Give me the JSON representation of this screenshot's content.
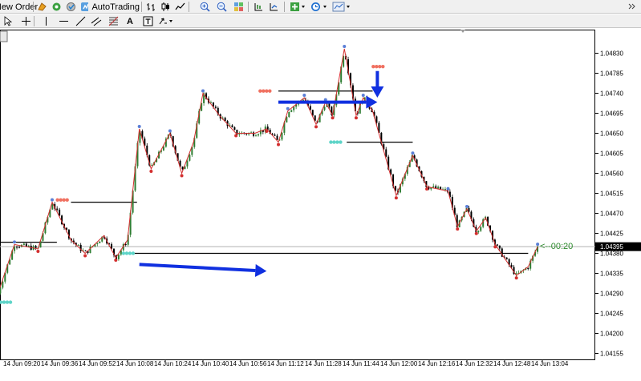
{
  "toolbar": {
    "new_order_label": "New Order",
    "autotrading_label": "AutoTrading",
    "icons": [
      "new-order-icon",
      "expert-icon",
      "signals-icon",
      "autotrading-icon",
      "bar-chart-icon",
      "candlestick-icon",
      "line-chart-icon",
      "zoom-in-icon",
      "zoom-out-icon",
      "tile-windows-icon",
      "chart-shift-icon",
      "autoscroll-icon",
      "indicators-icon",
      "periods-icon",
      "templates-icon"
    ]
  },
  "drawing_toolbar": {
    "icons": [
      "cursor-icon",
      "crosshair-icon",
      "vertical-line-icon",
      "horizontal-line-icon",
      "trendline-icon",
      "equidistant-channel-icon",
      "fibonacci-icon",
      "text-label-icon",
      "text-icon",
      "arrows-icon"
    ],
    "text_tool_label": "A"
  },
  "colors": {
    "bull_candle": "#2e7d32",
    "bear_candle": "#000000",
    "zigzag_line": "#d32f2f",
    "high_dot": "#5b7fd6",
    "low_dot": "#d32f2f",
    "resistance_marker": "#f07060",
    "support_marker": "#5ed4c8",
    "arrow": "#1030e0",
    "countdown_text": "#2e8b2e",
    "price_tag_bg": "#000000"
  },
  "chart_data": {
    "type": "candlestick",
    "y_ticks": [
      "1.04830",
      "1.04785",
      "1.04740",
      "1.04695",
      "1.04650",
      "1.04605",
      "1.04560",
      "1.04515",
      "1.04470",
      "1.04425",
      "1.04380",
      "1.04335",
      "1.04290",
      "1.04245",
      "1.04200",
      "1.04155"
    ],
    "y_values": [
      1.0483,
      1.04785,
      1.0474,
      1.04695,
      1.0465,
      1.04605,
      1.0456,
      1.04515,
      1.0447,
      1.04425,
      1.0438,
      1.04335,
      1.0429,
      1.04245,
      1.042,
      1.04155
    ],
    "x_ticks": [
      "14 Jun 09:20",
      "14 Jun 09:36",
      "14 Jun 09:52",
      "14 Jun 10:08",
      "14 Jun 10:24",
      "14 Jun 10:40",
      "14 Jun 10:56",
      "14 Jun 11:12",
      "14 Jun 11:28",
      "14 Jun 11:44",
      "14 Jun 12:00",
      "14 Jun 12:16",
      "14 Jun 12:32",
      "14 Jun 12:48",
      "14 Jun 13:04"
    ],
    "current_price": "1.04395",
    "current_price_value": 1.04395,
    "countdown": "<--00:20",
    "path": [
      [
        "09:13",
        1.0429
      ],
      [
        "09:20",
        1.044
      ],
      [
        "09:30",
        1.0439
      ],
      [
        "09:36",
        1.04495
      ],
      [
        "09:44",
        1.0441
      ],
      [
        "09:50",
        1.0438
      ],
      [
        "09:58",
        1.0442
      ],
      [
        "10:03",
        1.0437
      ],
      [
        "10:08",
        1.0441
      ],
      [
        "10:13",
        1.0466
      ],
      [
        "10:18",
        1.0457
      ],
      [
        "10:26",
        1.0465
      ],
      [
        "10:31",
        1.0456
      ],
      [
        "10:36",
        1.0463
      ],
      [
        "10:40",
        1.0474
      ],
      [
        "10:47",
        1.0469
      ],
      [
        "10:54",
        1.0465
      ],
      [
        "11:02",
        1.0465
      ],
      [
        "11:07",
        1.0466
      ],
      [
        "11:12",
        1.0463
      ],
      [
        "11:16",
        1.047
      ],
      [
        "11:23",
        1.0473
      ],
      [
        "11:28",
        1.0467
      ],
      [
        "11:32",
        1.0472
      ],
      [
        "11:35",
        1.0469
      ],
      [
        "11:40",
        1.0484
      ],
      [
        "11:45",
        1.0469
      ],
      [
        "11:48",
        1.0473
      ],
      [
        "11:52",
        1.047
      ],
      [
        "12:02",
        1.0451
      ],
      [
        "12:09",
        1.046
      ],
      [
        "12:15",
        1.0453
      ],
      [
        "12:24",
        1.0452
      ],
      [
        "12:28",
        1.0444
      ],
      [
        "12:32",
        1.0448
      ],
      [
        "12:36",
        1.0443
      ],
      [
        "12:40",
        1.0446
      ],
      [
        "12:44",
        1.044
      ],
      [
        "12:53",
        1.0433
      ],
      [
        "12:58",
        1.0435
      ],
      [
        "13:02",
        1.04395
      ]
    ],
    "zigzag_highs": [
      [
        "09:20",
        1.044
      ],
      [
        "09:36",
        1.04495
      ],
      [
        "10:13",
        1.0466
      ],
      [
        "10:26",
        1.0465
      ],
      [
        "10:40",
        1.0474
      ],
      [
        "11:16",
        1.047
      ],
      [
        "11:23",
        1.0473
      ],
      [
        "11:32",
        1.0472
      ],
      [
        "11:40",
        1.0484
      ],
      [
        "11:48",
        1.0473
      ],
      [
        "12:09",
        1.046
      ],
      [
        "12:24",
        1.0452
      ],
      [
        "12:32",
        1.0448
      ],
      [
        "13:02",
        1.04395
      ]
    ],
    "zigzag_lows": [
      [
        "09:30",
        1.0439
      ],
      [
        "09:50",
        1.0438
      ],
      [
        "10:03",
        1.0437
      ],
      [
        "10:18",
        1.0457
      ],
      [
        "10:31",
        1.0456
      ],
      [
        "10:54",
        1.0465
      ],
      [
        "11:07",
        1.0466
      ],
      [
        "11:12",
        1.0463
      ],
      [
        "11:28",
        1.0467
      ],
      [
        "11:35",
        1.0469
      ],
      [
        "11:45",
        1.0469
      ],
      [
        "12:02",
        1.0451
      ],
      [
        "12:15",
        1.0453
      ],
      [
        "12:28",
        1.0444
      ],
      [
        "12:36",
        1.0443
      ],
      [
        "12:44",
        1.044
      ],
      [
        "12:53",
        1.0433
      ]
    ],
    "level_lines": [
      {
        "name": "support-left",
        "from": "08:58",
        "to": "09:38",
        "price": 1.04405,
        "color": "#000000"
      },
      {
        "name": "resistance-1",
        "from": "09:44",
        "to": "10:12",
        "price": 1.04495,
        "color": "#000000"
      },
      {
        "name": "support-current",
        "from": "10:08",
        "to": "12:58",
        "price": 1.0438,
        "color": "#000000"
      },
      {
        "name": "resistance-2",
        "from": "11:12",
        "to": "11:52",
        "price": 1.04745,
        "color": "#000000"
      },
      {
        "name": "support-mid",
        "from": "11:41",
        "to": "12:09",
        "price": 1.0463,
        "color": "#000000"
      }
    ],
    "markers": [
      {
        "name": "resistance-marker",
        "time": "09:41",
        "price": 1.045,
        "kind": "resistance"
      },
      {
        "name": "resistance-marker",
        "time": "11:07",
        "price": 1.04745,
        "kind": "resistance"
      },
      {
        "name": "resistance-marker",
        "time": "11:55",
        "price": 1.048,
        "kind": "resistance"
      },
      {
        "name": "support-marker",
        "time": "11:37",
        "price": 1.0463,
        "kind": "support"
      },
      {
        "name": "support-marker",
        "time": "10:09",
        "price": 1.0438,
        "kind": "support"
      },
      {
        "name": "support-marker",
        "time": "09:13",
        "price": 1.0427,
        "kind": "support"
      }
    ],
    "arrows": [
      {
        "name": "arrow-right-upper",
        "from": [
          "11:12",
          1.0472
        ],
        "to": [
          "11:54",
          1.0472
        ]
      },
      {
        "name": "arrow-down",
        "from": [
          "11:54",
          1.0479
        ],
        "to": [
          "11:54",
          1.0473
        ]
      },
      {
        "name": "arrow-right-lower",
        "from": [
          "10:13",
          1.04355
        ],
        "to": [
          "11:07",
          1.0434
        ]
      }
    ]
  }
}
